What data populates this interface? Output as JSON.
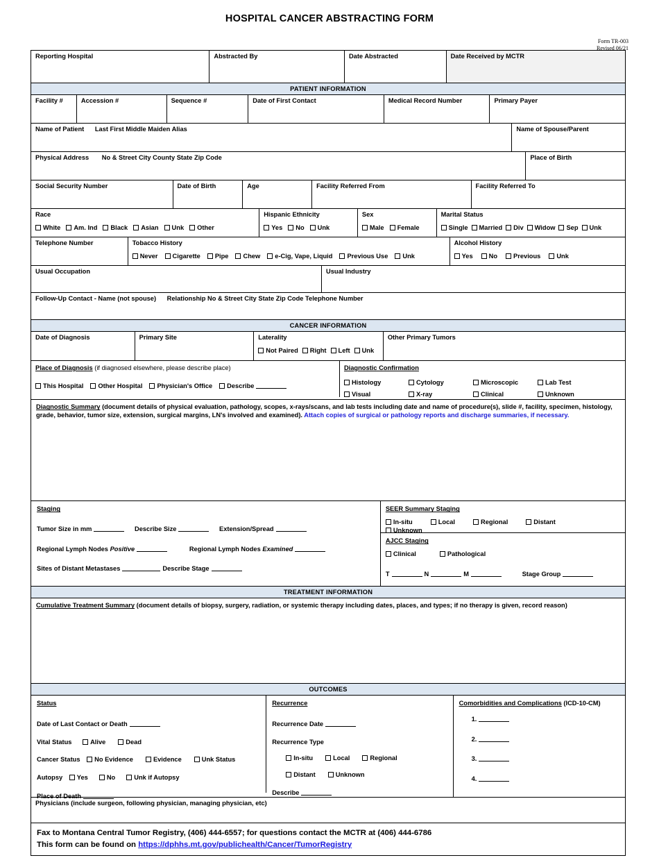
{
  "document": {
    "title": "HOSPITAL CANCER ABSTRACTING FORM",
    "form_number": "Form TR-003\nRevised 06/21"
  },
  "header_row": {
    "reporting_hospital": "Reporting Hospital",
    "abstracted_by": "Abstracted By",
    "date_abstracted": "Date Abstracted",
    "date_received": "Date Received by MCTR"
  },
  "sections": {
    "patient_information": "PATIENT INFORMATION",
    "cancer_information": "CANCER INFORMATION",
    "treatment_information": "TREATMENT INFORMATION",
    "outcomes": "OUTCOMES"
  },
  "patient": {
    "facility_no": "Facility #",
    "accession_no": "Accession #",
    "sequence_no": "Sequence #",
    "date_of_first_contact": "Date of First Contact",
    "medical_record_number": "Medical Record Number",
    "primary_payer": "Primary Payer",
    "name_of_patient": "Name of Patient",
    "name_of_patient_parts": "Last   First   Middle   Maiden   Alias",
    "name_of_spouse": "Name of Spouse/Parent",
    "physical_address": "Physical Address",
    "physical_address_parts": "No & Street   City   County   State   Zip Code",
    "place_of_birth": "Place of Birth",
    "social_security_number": "Social Security Number",
    "date_of_birth": "Date of Birth",
    "age": "Age",
    "facility_referred_from": "Facility Referred From",
    "facility_referred_to": "Facility Referred To",
    "race_label": "Race",
    "race_options": [
      "White",
      "Am. Ind",
      "Black",
      "Asian",
      "Unk",
      "Other"
    ],
    "hispanic_label": "Hispanic Ethnicity",
    "hispanic_options": [
      "Yes",
      "No",
      "Unk"
    ],
    "sex_label": "Sex",
    "sex_options": [
      "Male",
      "Female"
    ],
    "marital_label": "Marital Status",
    "marital_options": [
      "Single",
      "Married",
      "Div",
      "Widow",
      "Sep",
      "Unk"
    ],
    "telephone_number": "Telephone Number",
    "tobacco_label": "Tobacco History",
    "tobacco_options": [
      "Never",
      "Cigarette",
      "Pipe",
      "Chew",
      "e-Cig, Vape, Liquid",
      "Previous Use",
      "Unk"
    ],
    "alcohol_label": "Alcohol History",
    "alcohol_options": [
      "Yes",
      "No",
      "Previous",
      "Unk"
    ],
    "usual_occupation": "Usual Occupation",
    "usual_industry": "Usual Industry",
    "followup_contact": "Follow-Up Contact - Name (not spouse)",
    "followup_parts": "Relationship   No & Street   City   State   Zip Code   Telephone Number"
  },
  "cancer": {
    "date_of_diagnosis": "Date of Diagnosis",
    "primary_site": "Primary Site",
    "laterality_label": "Laterality",
    "laterality_options": [
      "Not Paired",
      "Right",
      "Left",
      "Unk"
    ],
    "other_primary_tumors": "Other Primary Tumors",
    "place_of_diagnosis_label": "Place of Diagnosis",
    "place_of_diagnosis_note": " (if diagnosed elsewhere, please describe place)",
    "place_of_diagnosis_options": [
      "This Hospital",
      "Other Hospital",
      "Physician's Office",
      "Describe"
    ],
    "diagnostic_confirmation_label": "Diagnostic Confirmation",
    "diagnostic_confirmation_options": [
      "Histology",
      "Cytology",
      "Microscopic",
      "Lab Test",
      "Visual",
      "X-ray",
      "Clinical",
      "Unknown"
    ],
    "diagnostic_summary_label": "Diagnostic Summary",
    "diagnostic_summary_note": " (document details of physical evaluation, pathology, scopes, x-rays/scans, and lab tests including date and name of procedure(s), slide #, facility, specimen, histology, grade, behavior, tumor size, extension, surgical margins, LN's involved and examined). ",
    "diagnostic_summary_blue": "Attach copies of surgical or pathology reports and discharge summaries, if necessary."
  },
  "staging": {
    "label": "Staging",
    "tumor_size": "Tumor Size in mm",
    "describe_size": "Describe Size",
    "extension_spread": "Extension/Spread",
    "rln_positive_pre": "Regional Lymph Nodes ",
    "rln_positive_italic": "Positive",
    "rln_examined_pre": "Regional Lymph Nodes ",
    "rln_examined_italic": "Examined",
    "sites_distant_metastases": "Sites of Distant Metastases",
    "describe_stage": "Describe Stage",
    "seer_label": "SEER Summary Staging",
    "seer_options": [
      "In-situ",
      "Local",
      "Regional",
      "Distant",
      "Unknown"
    ],
    "ajcc_label": "AJCC Staging",
    "ajcc_options": [
      "Clinical",
      "Pathological"
    ],
    "t_label": "T",
    "n_label": "N",
    "m_label": "M",
    "stage_group": "Stage Group"
  },
  "treatment": {
    "cumulative_label": "Cumulative Treatment Summary",
    "cumulative_note": " (document details of biopsy, surgery, radiation, or systemic therapy including dates, places, and types; if no therapy is given, record reason)"
  },
  "outcomes": {
    "status_label": "Status",
    "date_last_contact": "Date of Last Contact or Death",
    "vital_status_label": "Vital Status",
    "vital_status_options": [
      "Alive",
      "Dead"
    ],
    "cancer_status_label": "Cancer Status",
    "cancer_status_options": [
      "No Evidence",
      "Evidence",
      "Unk Status"
    ],
    "autopsy_label": "Autopsy",
    "autopsy_options": [
      "Yes",
      "No",
      "Unk if Autopsy"
    ],
    "place_of_death": "Place of Death",
    "recurrence_label": "Recurrence",
    "recurrence_date": "Recurrence Date",
    "recurrence_type": "Recurrence Type",
    "recurrence_options": [
      "In-situ",
      "Local",
      "Regional",
      "Distant",
      "Unknown"
    ],
    "describe": "Describe",
    "comorbidities_label": "Comorbidities and Complications",
    "comorbidities_note": " (ICD-10-CM)",
    "comorbidities_items": [
      "1.",
      "2.",
      "3.",
      "4."
    ],
    "physicians": "Physicians (include surgeon, following physician, managing physician, etc)"
  },
  "footer": {
    "line1": "Fax to Montana Central Tumor Registry, (406) 444-6557; for questions contact the MCTR at (406) 444-6786",
    "line2_pre": "This form can be found on ",
    "line2_link": "https://dphhs.mt.gov/publichealth/Cancer/TumorRegistry"
  },
  "colors": {
    "section_bar": "#dce6f1",
    "shaded_cell": "#f2f2f2",
    "blue_text": "#2424d8",
    "link": "#1a1ae0"
  }
}
